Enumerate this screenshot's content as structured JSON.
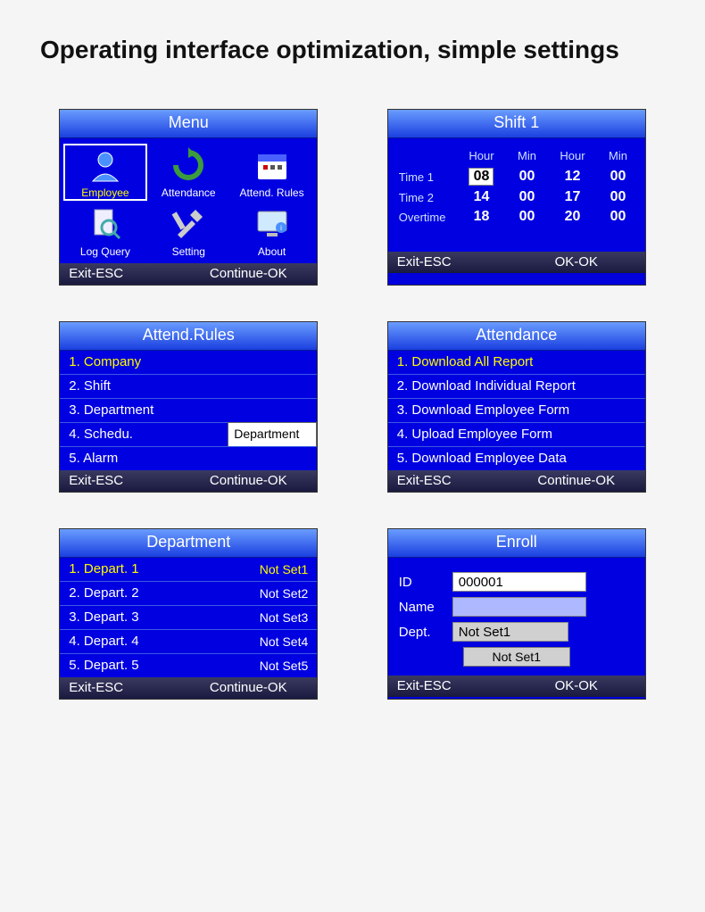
{
  "page": {
    "title": "Operating interface optimization, simple settings"
  },
  "screens": {
    "menu": {
      "title": "Menu",
      "items": [
        {
          "label": "Employee",
          "icon": "person",
          "selected": true
        },
        {
          "label": "Attendance",
          "icon": "cycle",
          "selected": false
        },
        {
          "label": "Attend. Rules",
          "icon": "calendar",
          "selected": false
        },
        {
          "label": "Log Query",
          "icon": "search-doc",
          "selected": false
        },
        {
          "label": "Setting",
          "icon": "tools",
          "selected": false
        },
        {
          "label": "About",
          "icon": "monitor",
          "selected": false
        }
      ],
      "footer_left": "Exit-ESC",
      "footer_right": "Continue-OK"
    },
    "shift": {
      "title": "Shift 1",
      "cols": [
        "Hour",
        "Min",
        "Hour",
        "Min"
      ],
      "rows": [
        {
          "label": "Time 1",
          "v": [
            "08",
            "00",
            "12",
            "00"
          ],
          "sel": 0
        },
        {
          "label": "Time 2",
          "v": [
            "14",
            "00",
            "17",
            "00"
          ],
          "sel": -1
        },
        {
          "label": "Overtime",
          "v": [
            "18",
            "00",
            "20",
            "00"
          ],
          "sel": -1
        }
      ],
      "footer_left": "Exit-ESC",
      "footer_right": "OK-OK"
    },
    "rules": {
      "title": "Attend.Rules",
      "items": [
        {
          "n": "1",
          "label": "Company",
          "highlight": true
        },
        {
          "n": "2",
          "label": "Shift"
        },
        {
          "n": "3",
          "label": "Department"
        },
        {
          "n": "4",
          "label": "Schedu.",
          "popup": "Department"
        },
        {
          "n": "5",
          "label": "Alarm"
        }
      ],
      "footer_left": "Exit-ESC",
      "footer_right": "Continue-OK"
    },
    "attendance": {
      "title": "Attendance",
      "items": [
        {
          "n": "1",
          "label": "Download All Report",
          "highlight": true
        },
        {
          "n": "2",
          "label": "Download Individual Report"
        },
        {
          "n": "3",
          "label": "Download Employee Form"
        },
        {
          "n": "4",
          "label": "Upload Employee Form"
        },
        {
          "n": "5",
          "label": "Download Employee Data"
        }
      ],
      "footer_left": "Exit-ESC",
      "footer_right": "Continue-OK"
    },
    "department": {
      "title": "Department",
      "items": [
        {
          "n": "1",
          "label": "Depart. 1",
          "right": "Not Set1",
          "highlight": true
        },
        {
          "n": "2",
          "label": "Depart. 2",
          "right": "Not Set2"
        },
        {
          "n": "3",
          "label": "Depart. 3",
          "right": "Not Set3"
        },
        {
          "n": "4",
          "label": "Depart. 4",
          "right": "Not Set4"
        },
        {
          "n": "5",
          "label": "Depart. 5",
          "right": "Not Set5"
        }
      ],
      "footer_left": "Exit-ESC",
      "footer_right": "Continue-OK"
    },
    "enroll": {
      "title": "Enroll",
      "id_label": "ID",
      "id_value": "000001",
      "name_label": "Name",
      "name_value": "",
      "dept_label": "Dept.",
      "dept_value": "Not Set1",
      "button": "Not Set1",
      "footer_left": "Exit-ESC",
      "footer_right": "OK-OK"
    }
  }
}
